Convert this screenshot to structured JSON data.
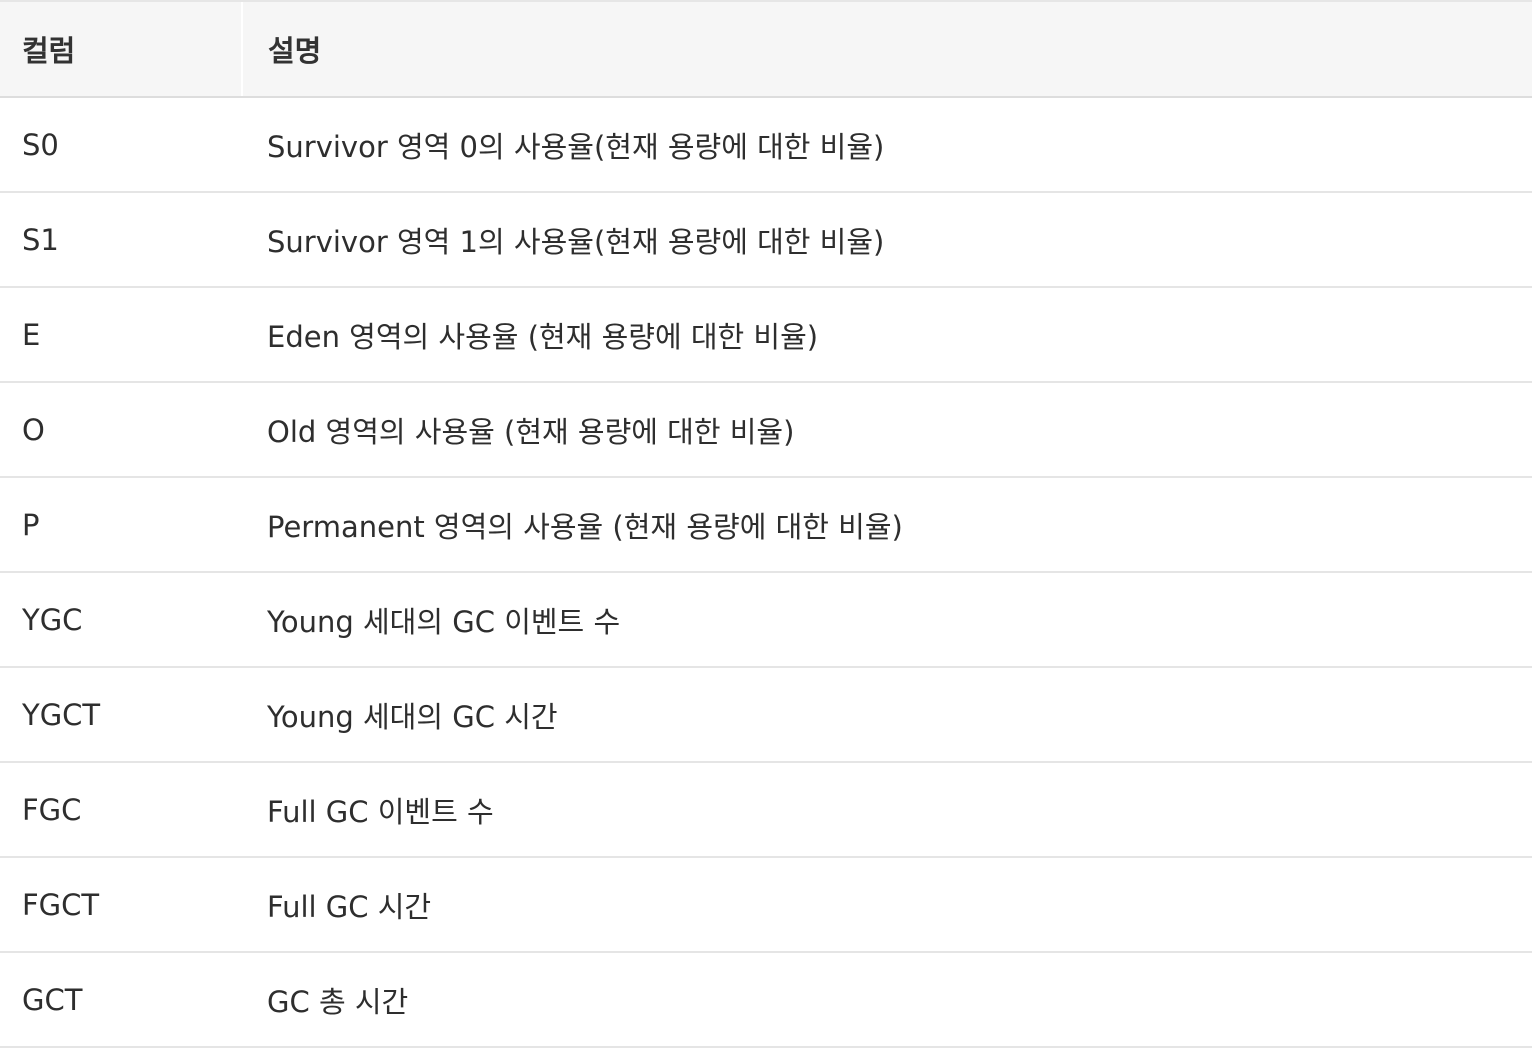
{
  "table": {
    "headers": [
      "컬럼",
      "설명"
    ],
    "rows": [
      {
        "column": "S0",
        "description": "Survivor 영역 0의 사용율(현재 용량에 대한 비율)"
      },
      {
        "column": "S1",
        "description": "Survivor 영역 1의 사용율(현재 용량에 대한 비율)"
      },
      {
        "column": "E",
        "description": "Eden 영역의 사용율 (현재 용량에 대한 비율)"
      },
      {
        "column": "O",
        "description": "Old 영역의 사용율 (현재 용량에 대한 비율)"
      },
      {
        "column": "P",
        "description": "Permanent 영역의 사용율 (현재 용량에 대한 비율)"
      },
      {
        "column": "YGC",
        "description": "Young 세대의 GC 이벤트 수"
      },
      {
        "column": "YGCT",
        "description": "Young 세대의 GC 시간"
      },
      {
        "column": "FGC",
        "description": "Full GC 이벤트 수"
      },
      {
        "column": "FGCT",
        "description": "Full GC 시간"
      },
      {
        "column": "GCT",
        "description": "GC 총 시간"
      }
    ]
  }
}
